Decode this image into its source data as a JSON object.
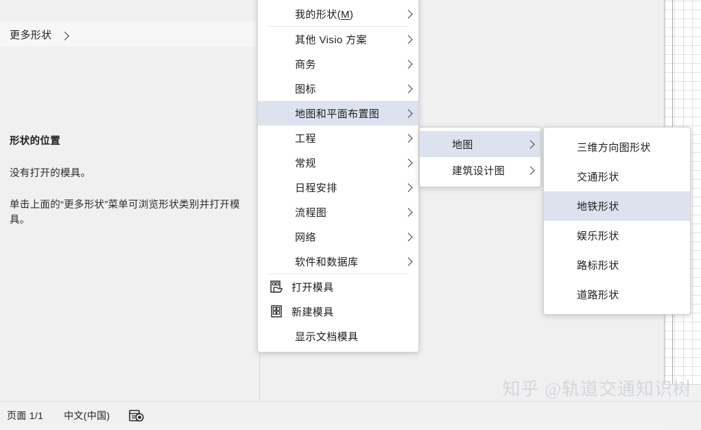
{
  "app": {
    "status_bar": {
      "page_label": "页面 1/1",
      "language": "中文(中国)",
      "macro_icon": "macro-recorder-icon"
    }
  },
  "shapes_panel": {
    "more_shapes_button": {
      "label": "更多形状",
      "arrow_icon": "chevron-right-icon"
    },
    "heading": "形状的位置",
    "text_1": "没有打开的模具。",
    "text_2": "单击上面的“更多形状”菜单可浏览形状类别并打开模具。"
  },
  "menu_level1": {
    "items": [
      {
        "label": "我的形状(M)",
        "accel": "M",
        "has_arrow": true,
        "divider_after": true,
        "highlighted": false,
        "icon": null
      },
      {
        "label": "其他 Visio 方案",
        "has_arrow": true,
        "divider_after": false,
        "highlighted": false,
        "icon": null
      },
      {
        "label": "商务",
        "has_arrow": true,
        "divider_after": false,
        "highlighted": false,
        "icon": null
      },
      {
        "label": "图标",
        "has_arrow": true,
        "divider_after": false,
        "highlighted": false,
        "icon": null
      },
      {
        "label": "地图和平面布置图",
        "has_arrow": true,
        "divider_after": false,
        "highlighted": true,
        "icon": null
      },
      {
        "label": "工程",
        "has_arrow": true,
        "divider_after": false,
        "highlighted": false,
        "icon": null
      },
      {
        "label": "常规",
        "has_arrow": true,
        "divider_after": false,
        "highlighted": false,
        "icon": null
      },
      {
        "label": "日程安排",
        "has_arrow": true,
        "divider_after": false,
        "highlighted": false,
        "icon": null
      },
      {
        "label": "流程图",
        "has_arrow": true,
        "divider_after": false,
        "highlighted": false,
        "icon": null
      },
      {
        "label": "网络",
        "has_arrow": true,
        "divider_after": false,
        "highlighted": false,
        "icon": null
      },
      {
        "label": "软件和数据库",
        "has_arrow": true,
        "divider_after": true,
        "highlighted": false,
        "icon": null
      },
      {
        "label": "打开模具",
        "has_arrow": false,
        "divider_after": false,
        "highlighted": false,
        "icon": "open-stencil-icon"
      },
      {
        "label": "新建模具",
        "has_arrow": false,
        "divider_after": false,
        "highlighted": false,
        "icon": "new-stencil-icon"
      },
      {
        "label": "显示文档模具",
        "has_arrow": false,
        "divider_after": false,
        "highlighted": false,
        "icon": null
      }
    ]
  },
  "menu_level2": {
    "items": [
      {
        "label": "地图",
        "has_arrow": true,
        "highlighted": true
      },
      {
        "label": "建筑设计图",
        "has_arrow": true,
        "highlighted": false
      }
    ]
  },
  "menu_level3": {
    "items": [
      {
        "label": "三维方向图形状",
        "highlighted": false
      },
      {
        "label": "交通形状",
        "highlighted": false
      },
      {
        "label": "地铁形状",
        "highlighted": true
      },
      {
        "label": "娱乐形状",
        "highlighted": false
      },
      {
        "label": "路标形状",
        "highlighted": false
      },
      {
        "label": "道路形状",
        "highlighted": false
      }
    ]
  },
  "watermark": {
    "text": "知乎 @轨道交通知识树"
  },
  "colors": {
    "menu_background": "#ffffff",
    "menu_highlight": "#dde2ef",
    "panel_background": "#f0f0f0",
    "status_bar_background": "#f1f1f1",
    "text_primary": "#1d1d1d",
    "watermark": "#d2d7dc"
  }
}
